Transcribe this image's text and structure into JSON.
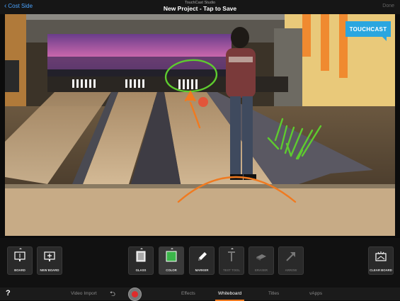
{
  "nav": {
    "back_label": "Cost Side",
    "app_name": "TouchCast Studio",
    "project_title": "New Project - Tap to Save",
    "done_label": "Done"
  },
  "stage": {
    "logo_text": "TOUCHCAST",
    "colors": {
      "logo": "#2aa6e0",
      "green_ink": "#5ecb2f",
      "orange_ink": "#f07a20"
    }
  },
  "toolbar": {
    "board": "BOARD",
    "new_board": "NEW BOARD",
    "glass": "GLASS",
    "color": "COLOR",
    "marker": "MARKER",
    "text_tool": "TEXT TOOL",
    "eraser": "ERASER",
    "arrow": "ARROW",
    "clear_board": "CLEAR BOARD",
    "selected_color": "#3bb54a"
  },
  "tabs": {
    "help": "?",
    "video_import": "Video Import",
    "effects": "Effects",
    "whiteboard": "Whiteboard",
    "titles": "Titles",
    "vapps": "vApps",
    "active": "Whiteboard"
  },
  "accent": "#f07a20"
}
